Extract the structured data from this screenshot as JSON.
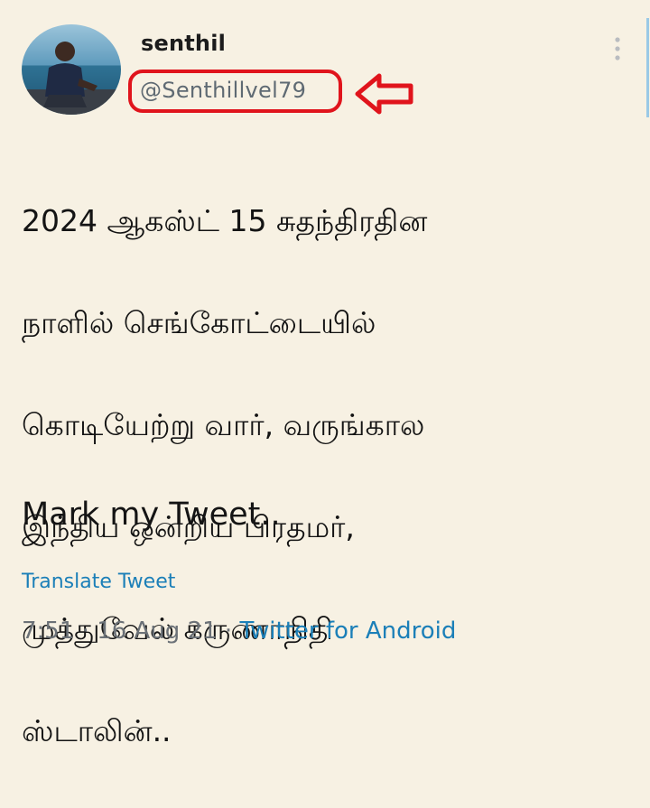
{
  "user": {
    "display_name": "senthil",
    "handle": "@Senthillvel79"
  },
  "tweet": {
    "lines": [
      "2024 ஆகஸ்ட் 15 சுதந்திரதின",
      "நாளில்  செங்கோட்டையில்",
      "கொடியேற்று வார், வருங்கால",
      "இந்திய ஒன்றிய பிரதமர்,",
      "முத்துவேல் கருணாநிதி",
      "ஸ்டாலின்.."
    ],
    "closing": "Mark my Tweet.."
  },
  "translate_label": "Translate Tweet",
  "meta": {
    "time": "7:51",
    "separator": "·",
    "date": "16 Aug 21",
    "source": "Twitter for Android"
  },
  "icons": {
    "more": "more-vertical-icon",
    "arrow": "left-arrow-annotation-icon"
  },
  "colors": {
    "background": "#f7f1e3",
    "highlight": "#e0141c",
    "link": "#1b7fb8",
    "muted": "#6b7177"
  }
}
